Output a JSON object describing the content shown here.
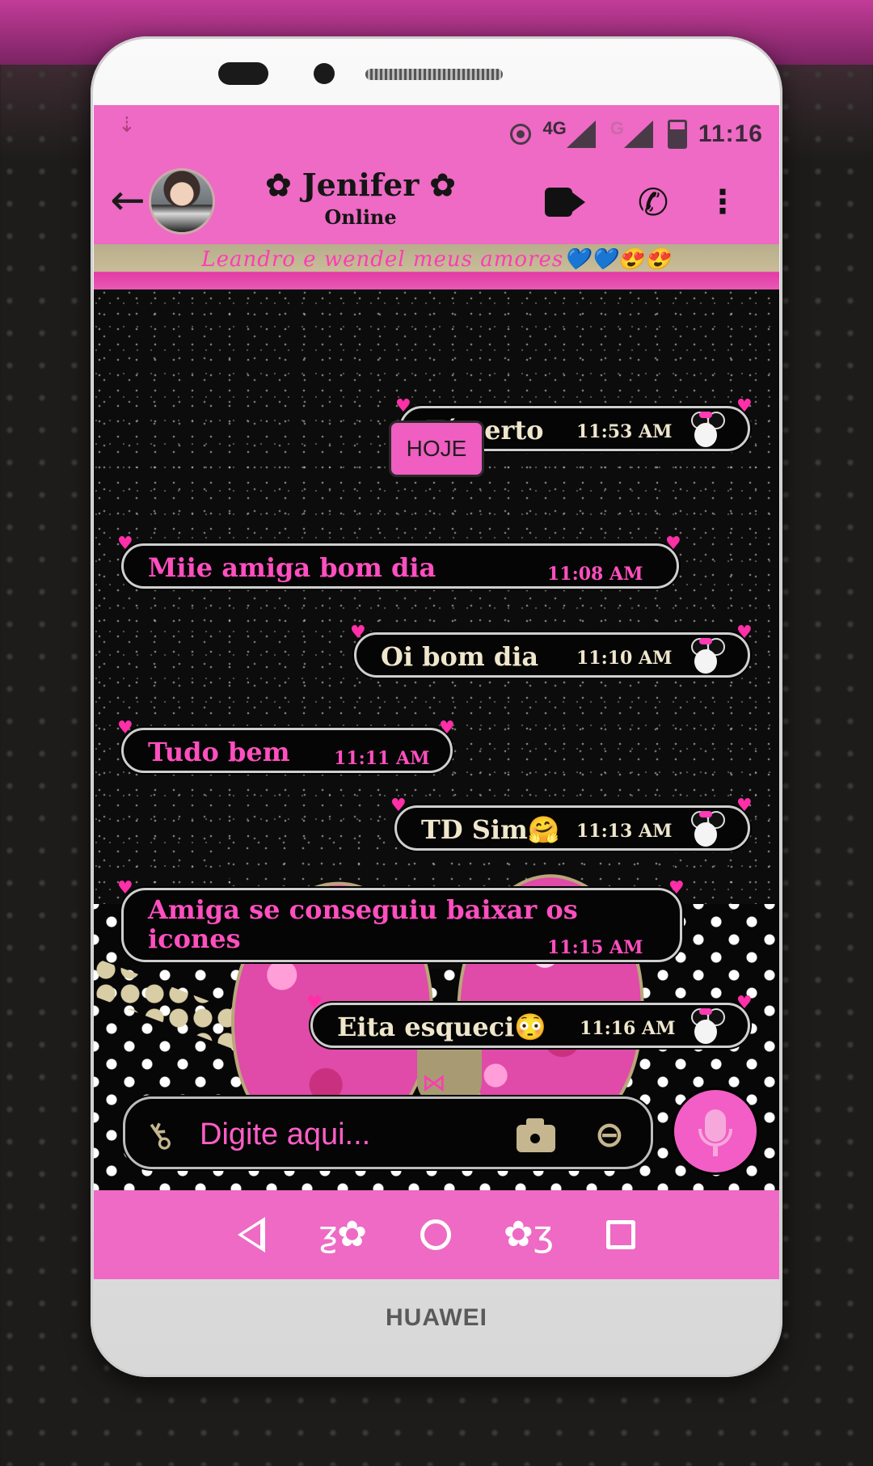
{
  "device": {
    "brand": "HUAWEI"
  },
  "status_bar": {
    "network_1": "4G",
    "network_2": "G",
    "time": "11:16"
  },
  "header": {
    "contact_name": "✿ Jenifer ✿",
    "contact_status": "Online",
    "icons": [
      "back-arrow-icon",
      "video-call-icon",
      "voice-call-icon",
      "more-menu-icon"
    ]
  },
  "banner": {
    "text": "Leandro e wendel meus amores💙💙😍😍"
  },
  "date_separator": "HOJE",
  "messages": [
    {
      "direction": "out",
      "text": "Tá certo",
      "time": "11:53 AM"
    },
    {
      "direction": "in",
      "text": "Miie amiga bom dia",
      "time": "11:08 AM"
    },
    {
      "direction": "out",
      "text": "Oi bom dia",
      "time": "11:10 AM"
    },
    {
      "direction": "in",
      "text": "Tudo bem",
      "time": "11:11 AM"
    },
    {
      "direction": "out",
      "text": "TD Sim🤗",
      "time": "11:13 AM"
    },
    {
      "direction": "in",
      "text": "Amiga se conseguiu baixar os icones",
      "time": "11:15 AM"
    },
    {
      "direction": "out",
      "text": "Eita esqueci😳",
      "time": "11:16 AM"
    }
  ],
  "composer": {
    "placeholder": "Digite aqui...",
    "value": ""
  },
  "colors": {
    "accent_pink": "#ee6ac4",
    "bubble_bg": "#050505",
    "incoming_text": "#ff4fbf",
    "outgoing_text": "#efe6cc",
    "gold": "#c5b68f"
  }
}
